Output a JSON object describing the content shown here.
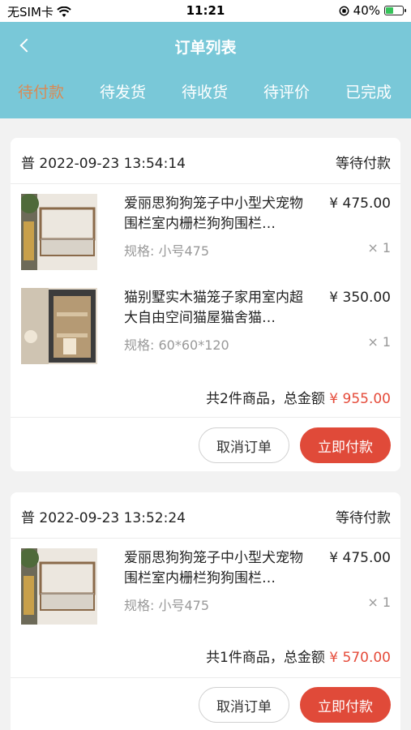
{
  "status_bar": {
    "carrier": "无SIM卡",
    "time": "11:21",
    "battery": "40%",
    "battery_level": 0.4
  },
  "header": {
    "title": "订单列表",
    "tabs": [
      {
        "label": "待付款",
        "active": true
      },
      {
        "label": "待发货",
        "active": false
      },
      {
        "label": "待收货",
        "active": false
      },
      {
        "label": "待评价",
        "active": false
      },
      {
        "label": "已完成",
        "active": false
      }
    ]
  },
  "orders": [
    {
      "prefix": "普",
      "datetime": "2022-09-23 13:54:14",
      "status": "等待付款",
      "items": [
        {
          "name": "爱丽思狗狗笼子中小型犬宠物围栏室内栅栏狗狗围栏…",
          "price": "¥ 475.00",
          "spec": "规格:  小号475",
          "qty": "× 1"
        },
        {
          "name": "猫别墅实木猫笼子家用室内超大自由空间猫屋猫舍猫…",
          "price": "¥ 350.00",
          "spec": "规格:  60*60*120",
          "qty": "× 1"
        }
      ],
      "summary_label": "共2件商品，总金额",
      "total": "¥ 955.00",
      "cancel_label": "取消订单",
      "pay_label": "立即付款"
    },
    {
      "prefix": "普",
      "datetime": "2022-09-23 13:52:24",
      "status": "等待付款",
      "items": [
        {
          "name": "爱丽思狗狗笼子中小型犬宠物围栏室内栅栏狗狗围栏…",
          "price": "¥ 475.00",
          "spec": "规格:  小号475",
          "qty": "× 1"
        }
      ],
      "summary_label": "共1件商品，总金额",
      "total": "¥ 570.00",
      "cancel_label": "取消订单",
      "pay_label": "立即付款"
    }
  ],
  "colors": {
    "header_bg": "#79c8d8",
    "active_tab": "#d98a55",
    "price_accent": "#e54b3a",
    "pay_button": "#e04a39"
  }
}
